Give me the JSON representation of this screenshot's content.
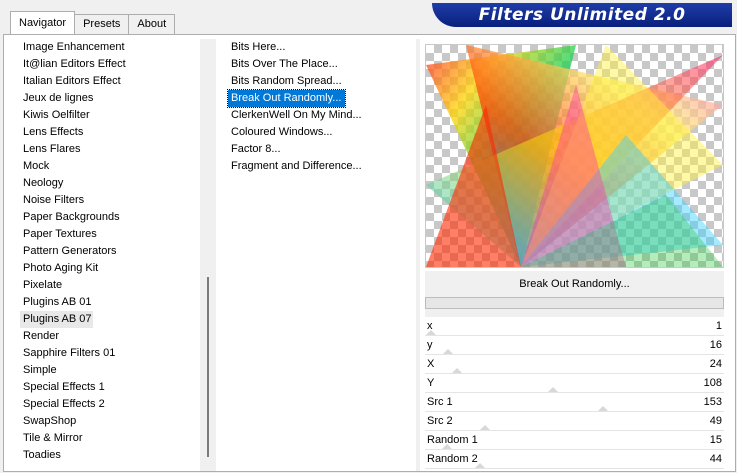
{
  "window": {
    "title": "Filters Unlimited 2.0"
  },
  "tabs": [
    {
      "label": "Navigator",
      "active": true
    },
    {
      "label": "Presets",
      "active": false
    },
    {
      "label": "About",
      "active": false
    }
  ],
  "categories": [
    "Image Enhancement",
    "It@lian Editors Effect",
    "Italian Editors Effect",
    "Jeux de lignes",
    "Kiwis Oelfilter",
    "Lens Effects",
    "Lens Flares",
    "Mock",
    "Neology",
    "Noise Filters",
    "Paper Backgrounds",
    "Paper Textures",
    "Pattern Generators",
    "Photo Aging Kit",
    "Pixelate",
    "Plugins AB 01",
    "Plugins AB 07",
    "Render",
    "Sapphire Filters 01",
    "Simple",
    "Special Effects 1",
    "Special Effects 2",
    "SwapShop",
    "Tile & Mirror",
    "Toadies"
  ],
  "highlighted_category": "Plugins AB 07",
  "filters": [
    "Bits Here...",
    "Bits Over The Place...",
    "Bits Random Spread...",
    "Break Out Randomly...",
    "ClerkenWell On My Mind...",
    "Coloured Windows...",
    "Factor 8...",
    "Fragment and Difference..."
  ],
  "selected_filter": "Break Out Randomly...",
  "filter_name_label": "Break Out Randomly...",
  "progress_fraction": 0,
  "parameters": [
    {
      "name": "x",
      "value": "1",
      "fraction": 0.004
    },
    {
      "name": "y",
      "value": "16",
      "fraction": 0.063
    },
    {
      "name": "X",
      "value": "24",
      "fraction": 0.094
    },
    {
      "name": "Y",
      "value": "108",
      "fraction": 0.424
    },
    {
      "name": "Src 1",
      "value": "153",
      "fraction": 0.6
    },
    {
      "name": "Src 2",
      "value": "49",
      "fraction": 0.192
    },
    {
      "name": "Random 1",
      "value": "15",
      "fraction": 0.059
    },
    {
      "name": "Random 2",
      "value": "44",
      "fraction": 0.173
    }
  ]
}
